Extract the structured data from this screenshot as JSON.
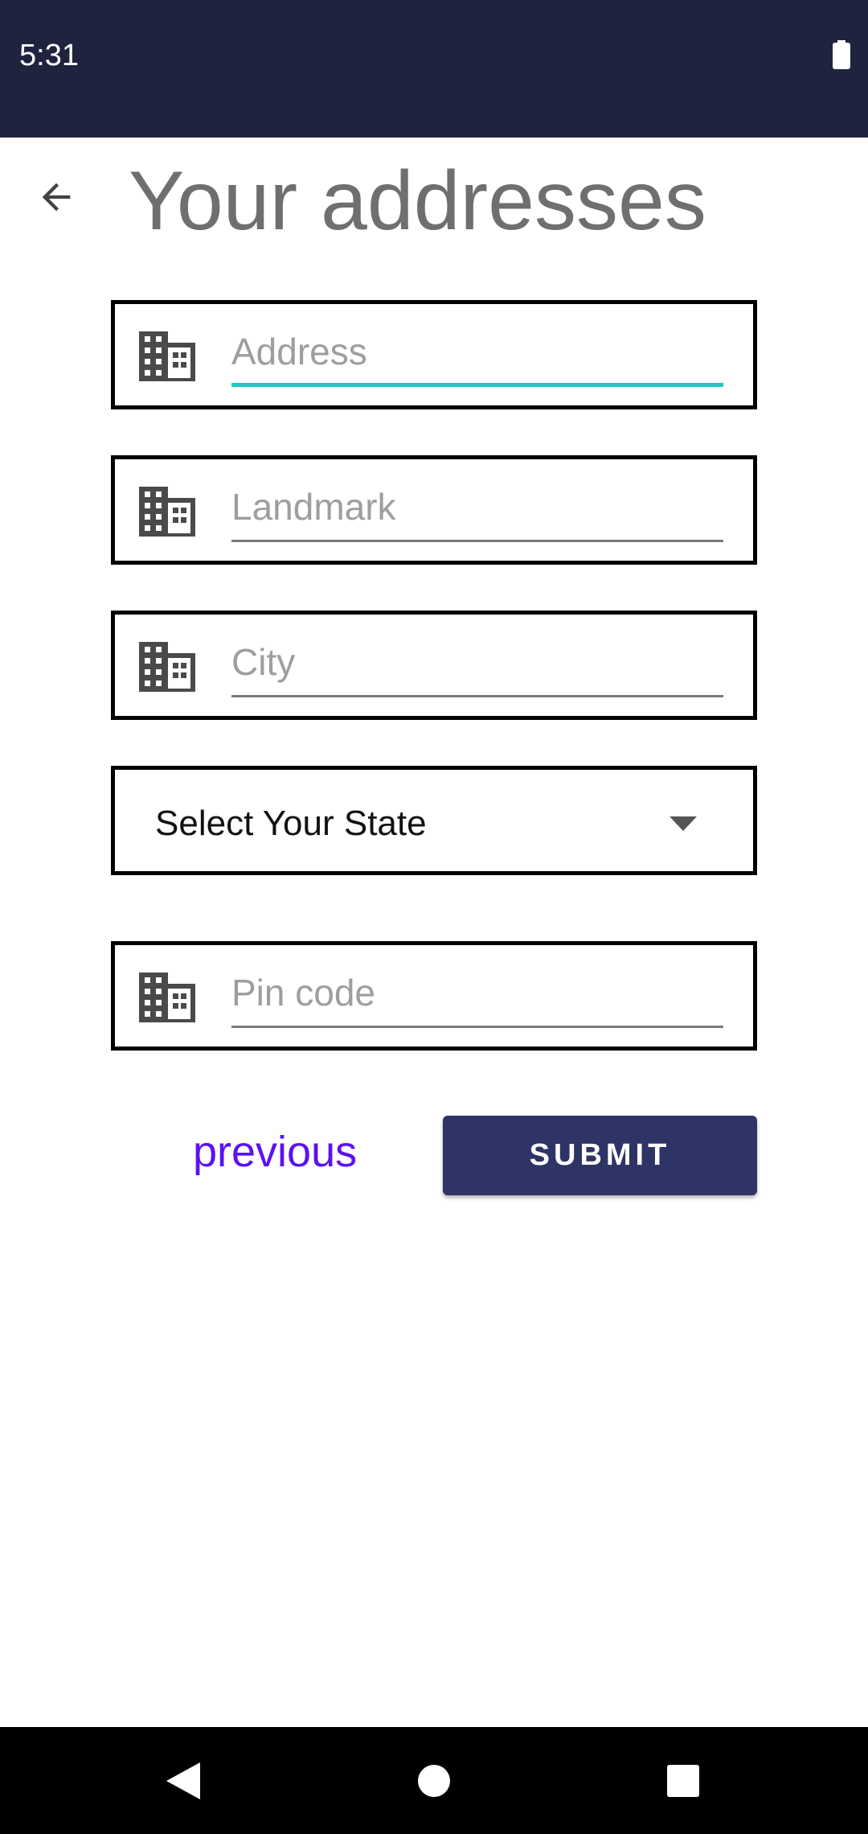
{
  "status_bar": {
    "time": "5:31",
    "battery_icon": "battery-full-icon"
  },
  "header": {
    "title": "Your addresses",
    "back_icon": "arrow-back-icon"
  },
  "form": {
    "address": {
      "placeholder": "Address",
      "value": "",
      "icon": "building-icon",
      "focused": true
    },
    "landmark": {
      "placeholder": "Landmark",
      "value": "",
      "icon": "building-icon"
    },
    "city": {
      "placeholder": "City",
      "value": "",
      "icon": "building-icon"
    },
    "state": {
      "label": "Select Your State",
      "icon": "dropdown-arrow-icon"
    },
    "pincode": {
      "placeholder": "Pin code",
      "value": "",
      "icon": "building-icon"
    }
  },
  "actions": {
    "previous_label": "previous",
    "submit_label": "SUBMIT"
  },
  "nav_bar": {
    "back": "nav-back-icon",
    "home": "nav-home-icon",
    "recents": "nav-recents-icon"
  },
  "colors": {
    "status_bar_bg": "#1f233d",
    "focus_accent": "#1fc8c0",
    "link_color": "#5b12f0",
    "submit_bg": "#2f3466"
  }
}
